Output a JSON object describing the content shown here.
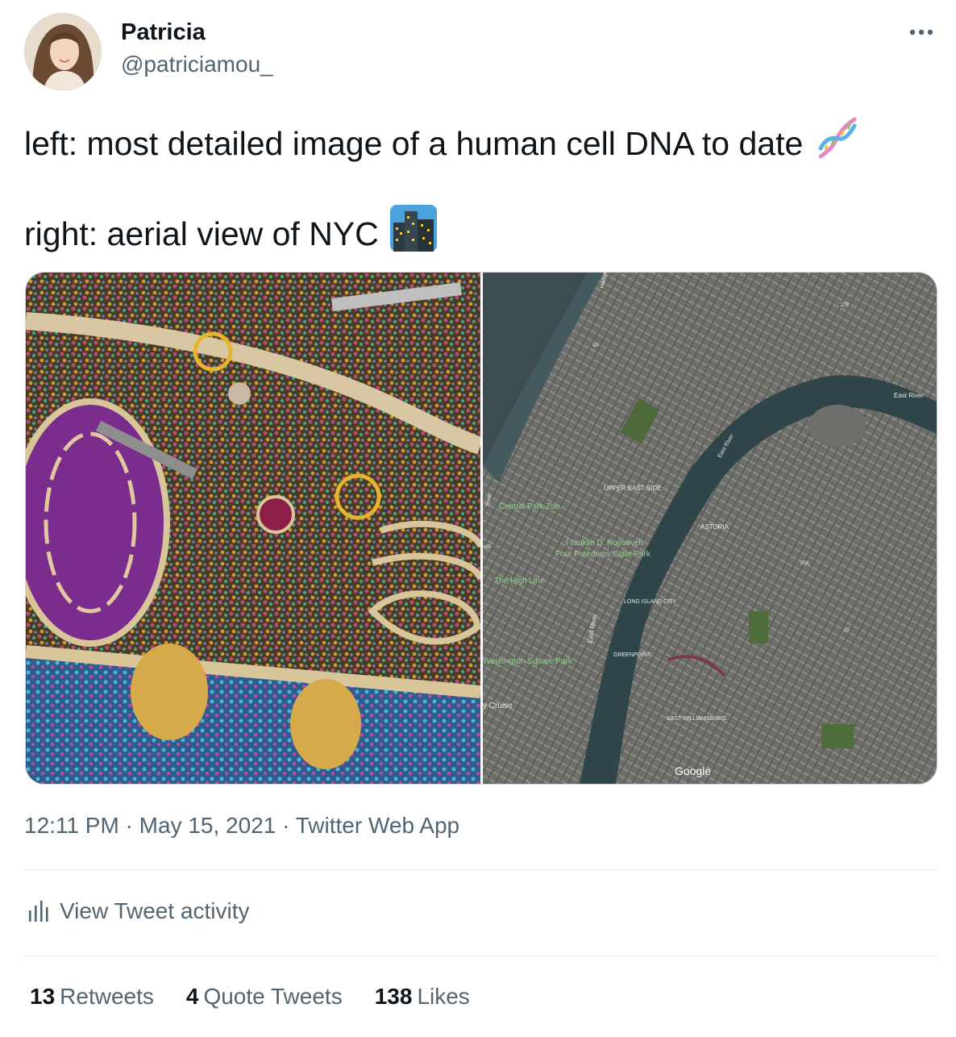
{
  "author": {
    "name": "Patricia",
    "handle": "@patriciamou_"
  },
  "tweet": {
    "line1": "left: most detailed image of a human cell DNA to date",
    "line1_emoji": "dna-emoji",
    "line2": "right: aerial view of NYC",
    "line2_emoji": "cityscape-emoji"
  },
  "media": {
    "left_image": "human-cell-illustration",
    "right_image": "nyc-satellite-map",
    "map_labels": {
      "east_river_top": "East River",
      "east_river_mid": "East River",
      "east_river_low": "East River",
      "central_park_zoo": "Central Park Zoo",
      "upper_east_side": "UPPER EAST SIDE",
      "astoria": "ASTORIA",
      "fdr_park_1": "Franklin D. Roosevelt",
      "fdr_park_2": "Four Freedoms State Park",
      "high_line": "The High Line",
      "long_island_city": "LONG ISLAND CITY",
      "washington_square": "Washington Square Park",
      "greenpoint": "GREENPOINT",
      "cruise": "y Cruise",
      "east_williamsburg": "EAST WILLIAMSBURG",
      "google": "Google",
      "hudson": "Hudso",
      "river_left": "River",
      "route_278": "278",
      "route_495": "495",
      "route_25a": "25A",
      "route_25": "25",
      "route_9a": "9A"
    }
  },
  "timestamp": {
    "time": "12:11 PM",
    "sep1": " · ",
    "date": "May 15, 2021",
    "sep2": " · ",
    "source": "Twitter Web App"
  },
  "activity_label": "View Tweet activity",
  "stats": [
    {
      "count": "13",
      "label": "Retweets"
    },
    {
      "count": "4",
      "label": "Quote Tweets"
    },
    {
      "count": "138",
      "label": "Likes"
    }
  ],
  "colors": {
    "text_primary": "#0f1419",
    "text_secondary": "#536471",
    "divider": "#e6ecf0"
  }
}
